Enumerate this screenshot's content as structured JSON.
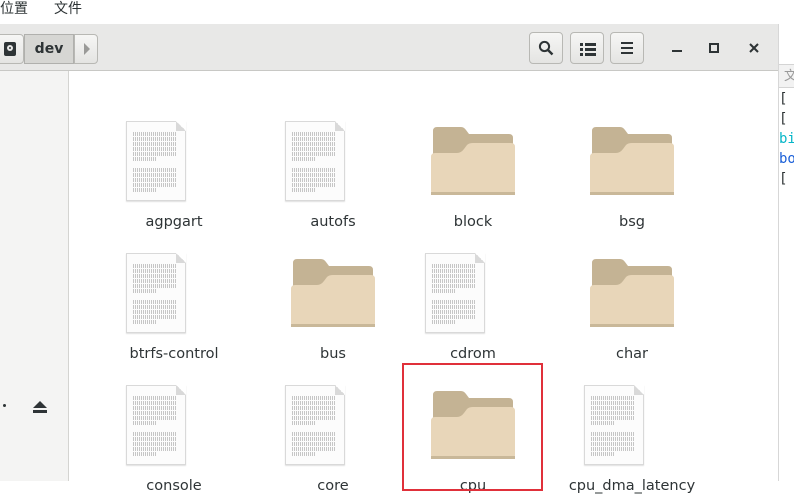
{
  "menubar": {
    "places_label": "位置",
    "file_label": "文件"
  },
  "window": {
    "path": {
      "current": "dev"
    },
    "controls": {
      "minimize": "–",
      "maximize": "□",
      "close": "×"
    }
  },
  "files": [
    {
      "name": "agpgart",
      "kind": "document"
    },
    {
      "name": "autofs",
      "kind": "document"
    },
    {
      "name": "block",
      "kind": "folder"
    },
    {
      "name": "bsg",
      "kind": "folder"
    },
    {
      "name": "btrfs-control",
      "kind": "document"
    },
    {
      "name": "bus",
      "kind": "folder"
    },
    {
      "name": "cdrom",
      "kind": "document"
    },
    {
      "name": "char",
      "kind": "folder"
    },
    {
      "name": "console",
      "kind": "document"
    },
    {
      "name": "core",
      "kind": "document"
    },
    {
      "name": "cpu",
      "kind": "folder",
      "highlighted": true
    },
    {
      "name": "cpu_dma_latency",
      "kind": "document"
    }
  ],
  "terminal": {
    "tab_label": "文",
    "lines": [
      {
        "text": "[ r",
        "color": "#2e3436"
      },
      {
        "text": "[ r",
        "color": "#2e3436"
      },
      {
        "text": "bi",
        "color": "#06b6c8"
      },
      {
        "text": "bo",
        "color": "#1a5fd8"
      },
      {
        "text": "[ r",
        "color": "#2e3436"
      }
    ]
  },
  "colors": {
    "highlight": "#e0303a",
    "folder_front": "#e8d6b9",
    "folder_back": "#c4b394"
  }
}
